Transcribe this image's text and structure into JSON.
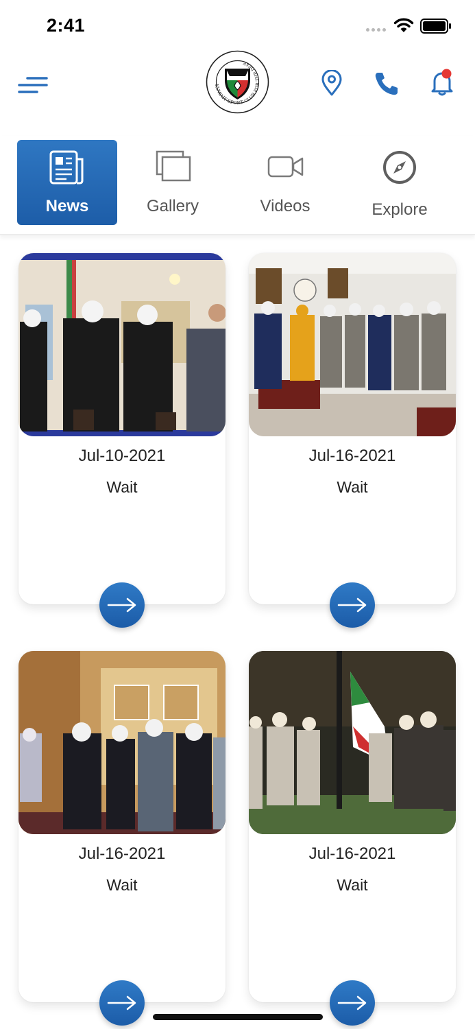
{
  "status_bar": {
    "time": "2:41"
  },
  "header": {
    "logo_text": "KUWAIT SPORT CLUB FOR THE DEAF"
  },
  "tabs": [
    {
      "label": "News",
      "icon": "newspaper-icon",
      "active": true
    },
    {
      "label": "Gallery",
      "icon": "gallery-icon",
      "active": false
    },
    {
      "label": "Videos",
      "icon": "video-icon",
      "active": false
    },
    {
      "label": "Explore",
      "icon": "compass-icon",
      "active": false
    }
  ],
  "news": [
    {
      "date": "Jul-10-2021",
      "title": "Wait"
    },
    {
      "date": "Jul-16-2021",
      "title": "Wait"
    },
    {
      "date": "Jul-16-2021",
      "title": "Wait"
    },
    {
      "date": "Jul-16-2021",
      "title": "Wait"
    }
  ],
  "colors": {
    "accent": "#2a6fbc",
    "notification_dot": "#e53935"
  }
}
